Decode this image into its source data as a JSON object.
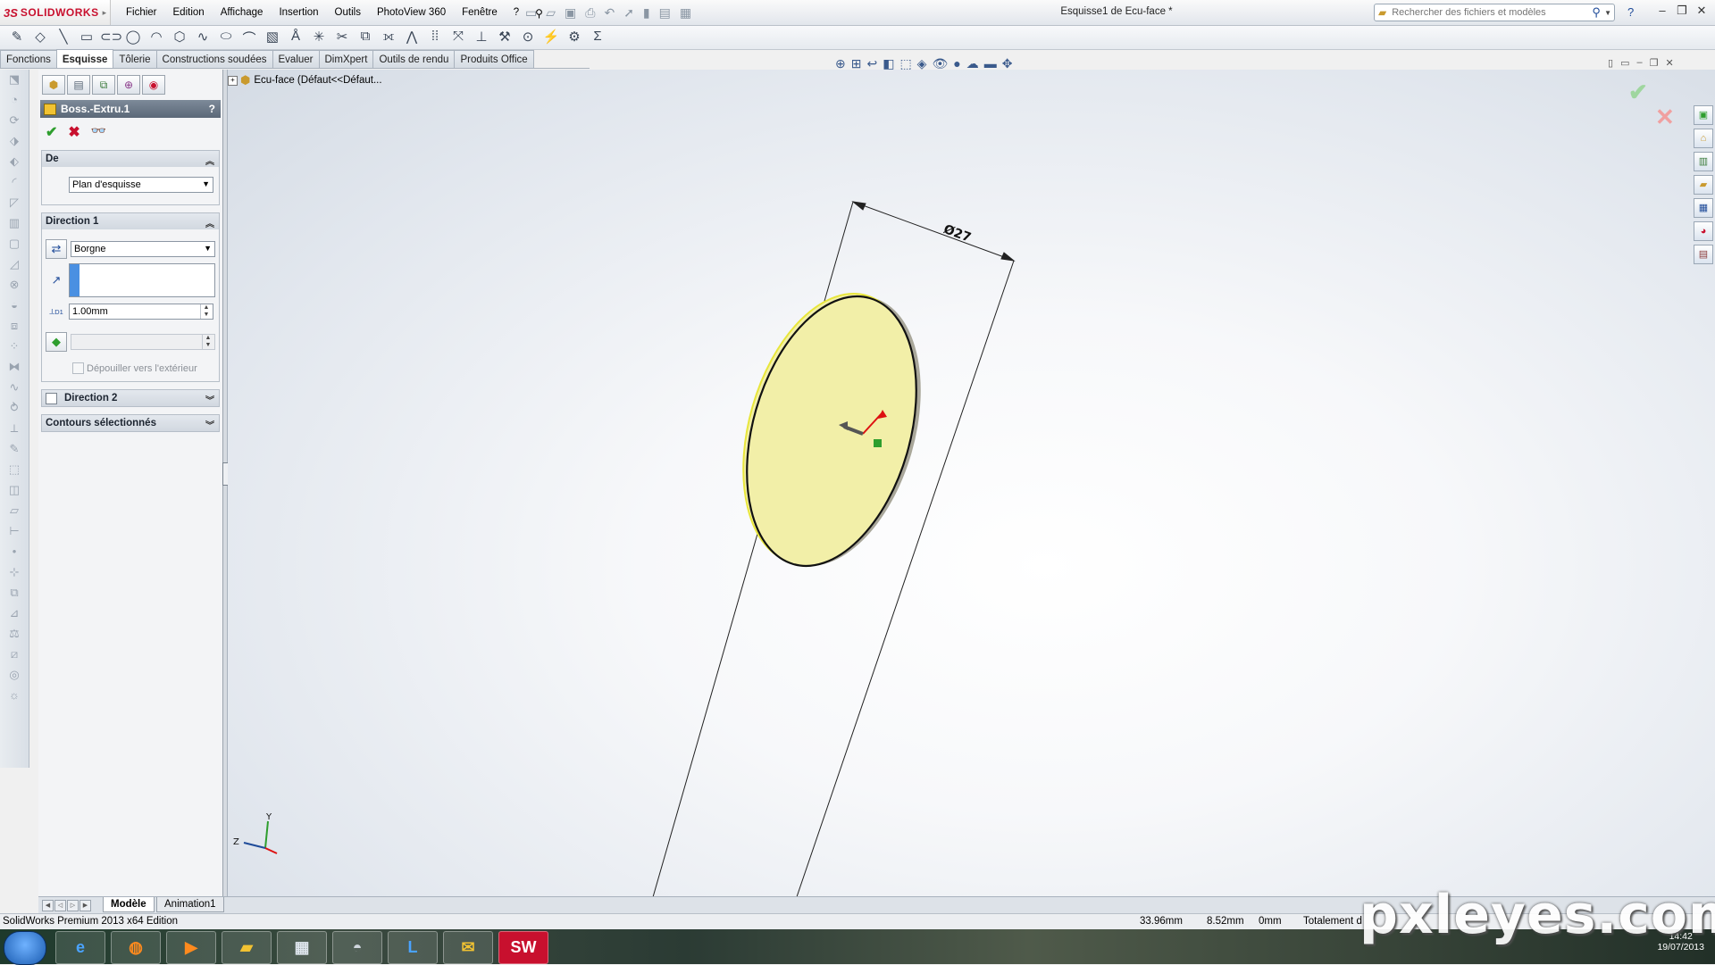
{
  "app": {
    "logo_ds": "3S",
    "logo_text": "SOLIDWORKS",
    "menus": [
      "Fichier",
      "Edition",
      "Affichage",
      "Insertion",
      "Outils",
      "PhotoView 360",
      "Fenêtre",
      "?"
    ],
    "document_title": "Esquisse1 de Ecu-face *",
    "search_placeholder": "Rechercher des fichiers et modèles",
    "help_label": "?"
  },
  "tabs": [
    {
      "label": "Fonctions",
      "active": false
    },
    {
      "label": "Esquisse",
      "active": true
    },
    {
      "label": "Tôlerie",
      "active": false
    },
    {
      "label": "Constructions soudées",
      "active": false
    },
    {
      "label": "Evaluer",
      "active": false
    },
    {
      "label": "DimXpert",
      "active": false
    },
    {
      "label": "Outils de rendu",
      "active": false
    },
    {
      "label": "Produits Office",
      "active": false
    }
  ],
  "property_manager": {
    "title": "Boss.-Extru.1",
    "help": "?",
    "groups": {
      "from": {
        "title": "De",
        "start_condition": "Plan d'esquisse"
      },
      "direction1": {
        "title": "Direction 1",
        "end_condition": "Borgne",
        "depth_value": "1.00mm",
        "depth_symbol": "D1",
        "draft_checkbox_label": "Dépouiller vers l'extérieur"
      },
      "direction2": {
        "title": "Direction 2"
      },
      "selected_contours": {
        "title": "Contours sélectionnés"
      }
    }
  },
  "graphics": {
    "tree_root_label": "Ecu-face  (Défaut<<Défaut...",
    "dimension_label": "Ø27",
    "triad_y": "Y",
    "triad_z": "Z",
    "disc_color": "#f2efa8",
    "disc_edge_color": "#b3b1a0"
  },
  "bottom_tabs": [
    {
      "label": "Modèle",
      "active": true
    },
    {
      "label": "Animation1",
      "active": false
    }
  ],
  "status_bar": {
    "product": "SolidWorks Premium 2013 x64 Edition",
    "x_coord": "33.96mm",
    "y_coord": "8.52mm",
    "z_coord": "0mm",
    "definition_state": "Totalement d"
  },
  "taskbar": {
    "time": "14:42",
    "date": "19/07/2013"
  },
  "watermark": "pxleyes.com"
}
